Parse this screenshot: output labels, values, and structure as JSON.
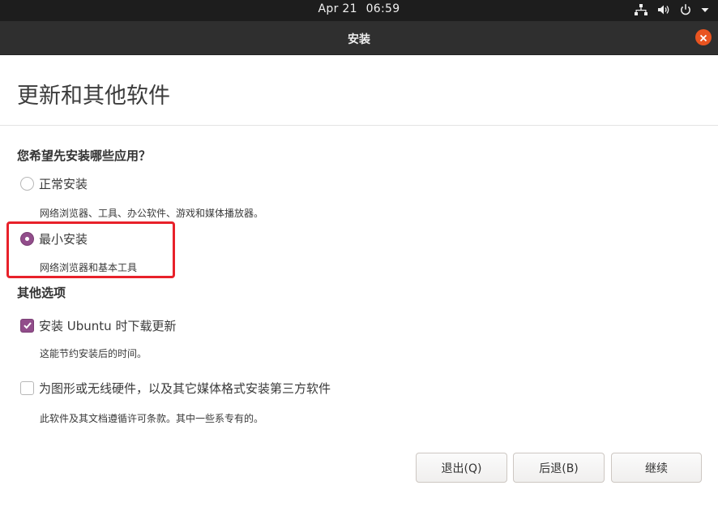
{
  "topbar": {
    "date": "Apr 21",
    "time": "06:59"
  },
  "window": {
    "title": "安装"
  },
  "page": {
    "title": "更新和其他软件"
  },
  "install_type": {
    "heading": "您希望先安装哪些应用？",
    "options": [
      {
        "label": "正常安装",
        "description": "网络浏览器、工具、办公软件、游戏和媒体播放器。",
        "selected": false
      },
      {
        "label": "最小安装",
        "description": "网络浏览器和基本工具",
        "selected": true
      }
    ]
  },
  "other_options": {
    "heading": "其他选项",
    "items": [
      {
        "label": "安装 Ubuntu 时下载更新",
        "description": "这能节约安装后的时间。",
        "checked": true
      },
      {
        "label": "为图形或无线硬件，以及其它媒体格式安装第三方软件",
        "description": "此软件及其文档遵循许可条款。其中一些系专有的。",
        "checked": false
      }
    ]
  },
  "buttons": {
    "quit": "退出(Q)",
    "back": "后退(B)",
    "continue": "继续"
  },
  "colors": {
    "accent": "#924d8b",
    "close": "#e95420",
    "highlight": "#e8212a"
  },
  "icons": [
    "network-icon",
    "volume-icon",
    "power-icon",
    "dropdown-arrow-icon",
    "close-icon",
    "checkmark-icon"
  ]
}
